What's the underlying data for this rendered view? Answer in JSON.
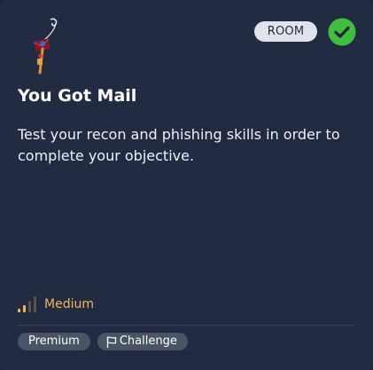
{
  "room": {
    "type_badge": "ROOM",
    "completed": true,
    "title": "You Got Mail",
    "description": "Test your recon and phishing skills in order to complete your objective.",
    "difficulty": "Medium",
    "logo_icon": "fishing-hook-icon",
    "status_icon": "check-circle-icon"
  },
  "tags": {
    "premium": "Premium",
    "challenge": "Challenge",
    "challenge_icon": "flag-icon"
  },
  "colors": {
    "card_background": "#212c42",
    "completed_green": "#3fbf3f",
    "difficulty_orange": "#f4b45a",
    "badge_background": "#e0e4ea",
    "tag_background": "#4a5467"
  }
}
